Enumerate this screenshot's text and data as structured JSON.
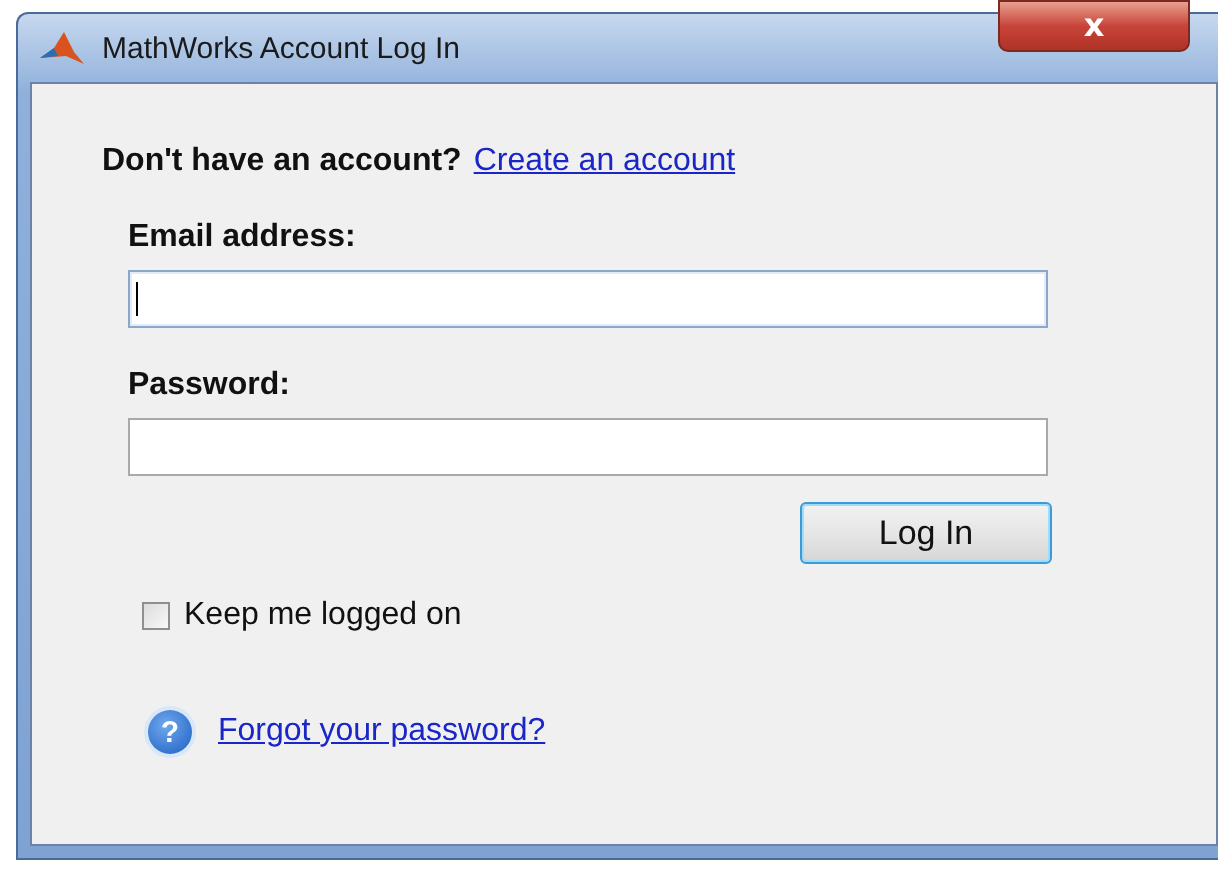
{
  "window": {
    "title": "MathWorks Account Log In",
    "close_label": "x"
  },
  "signup": {
    "prompt": "Don't have an account?",
    "link": "Create an account"
  },
  "fields": [
    {
      "label": "Email address:",
      "focused": true
    },
    {
      "label": "Password:",
      "focused": false
    }
  ],
  "login_button": "Log In",
  "keep_logged_on": {
    "label": "Keep me logged on",
    "checked": false
  },
  "forgot": {
    "icon": "?",
    "link": "Forgot your password?"
  }
}
